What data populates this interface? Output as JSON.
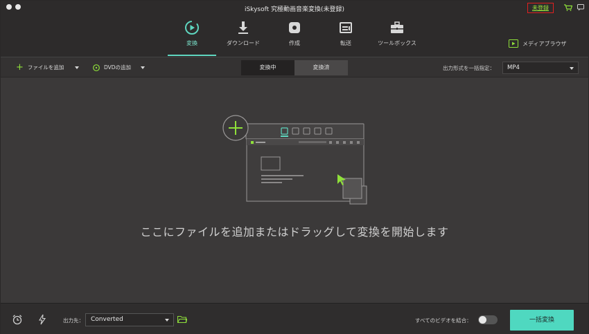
{
  "window": {
    "title": "iSkysoft 究極動画音楽変換(未登録)",
    "register_label": "未登録"
  },
  "nav": {
    "tabs": [
      {
        "label": "変換",
        "icon": "convert-icon",
        "active": true
      },
      {
        "label": "ダウンロード",
        "icon": "download-icon",
        "active": false
      },
      {
        "label": "作成",
        "icon": "disc-burn-icon",
        "active": false
      },
      {
        "label": "転送",
        "icon": "transfer-icon",
        "active": false
      },
      {
        "label": "ツールボックス",
        "icon": "toolbox-icon",
        "active": false
      }
    ],
    "media_browser_label": "メディアブラウザ"
  },
  "toolbar": {
    "add_files_label": "ファイルを追加",
    "add_dvd_label": "DVDの追加",
    "segments": [
      "変換中",
      "変換済"
    ],
    "active_segment": "変換中",
    "format_label": "出力形式を一括指定：",
    "format_value": "MP4"
  },
  "main": {
    "hint": "ここにファイルを追加またはドラッグして変換を開始します"
  },
  "bottom": {
    "output_label": "出力先：",
    "output_value": "Converted",
    "merge_label": "すべてのビデオを結合：",
    "merge_enabled": false,
    "convert_all_label": "一括変換"
  },
  "colors": {
    "accent_teal": "#4fd8c0",
    "accent_green": "#8fe03a",
    "background": "#3b3939",
    "register_border": "#e02020"
  }
}
